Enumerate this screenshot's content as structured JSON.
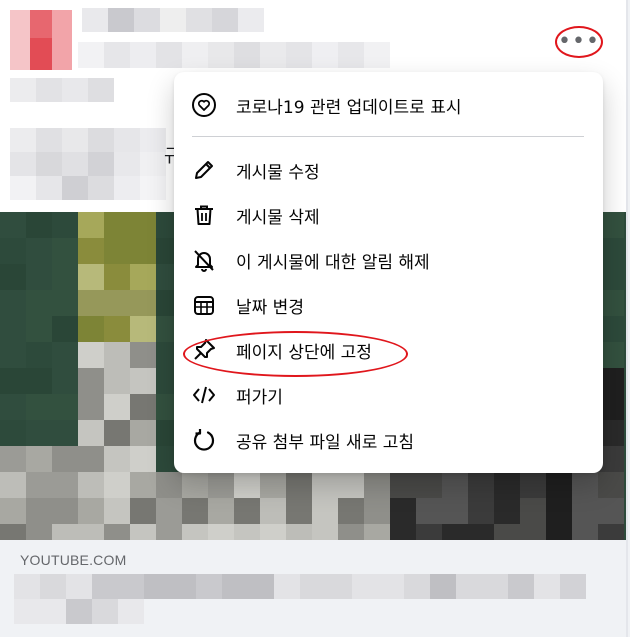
{
  "post": {
    "more_button_label": "•••",
    "partial_text": "규"
  },
  "link_preview": {
    "domain": "YOUTUBE.COM"
  },
  "menu": {
    "items": [
      {
        "label": "코로나19 관련 업데이트로 표시",
        "icon": "heart-badge-icon"
      },
      {
        "label": "게시물 수정",
        "icon": "pencil-icon"
      },
      {
        "label": "게시물 삭제",
        "icon": "trash-icon"
      },
      {
        "label": "이 게시물에 대한 알림 해제",
        "icon": "bell-off-icon"
      },
      {
        "label": "날짜 변경",
        "icon": "calendar-icon"
      },
      {
        "label": "페이지 상단에 고정",
        "icon": "pin-icon"
      },
      {
        "label": "퍼가기",
        "icon": "code-icon"
      },
      {
        "label": "공유 첨부 파일 새로 고침",
        "icon": "refresh-icon"
      }
    ]
  },
  "colors": {
    "annotation_red": "#e0161c",
    "menu_text": "#050505",
    "secondary_text": "#65676b"
  }
}
